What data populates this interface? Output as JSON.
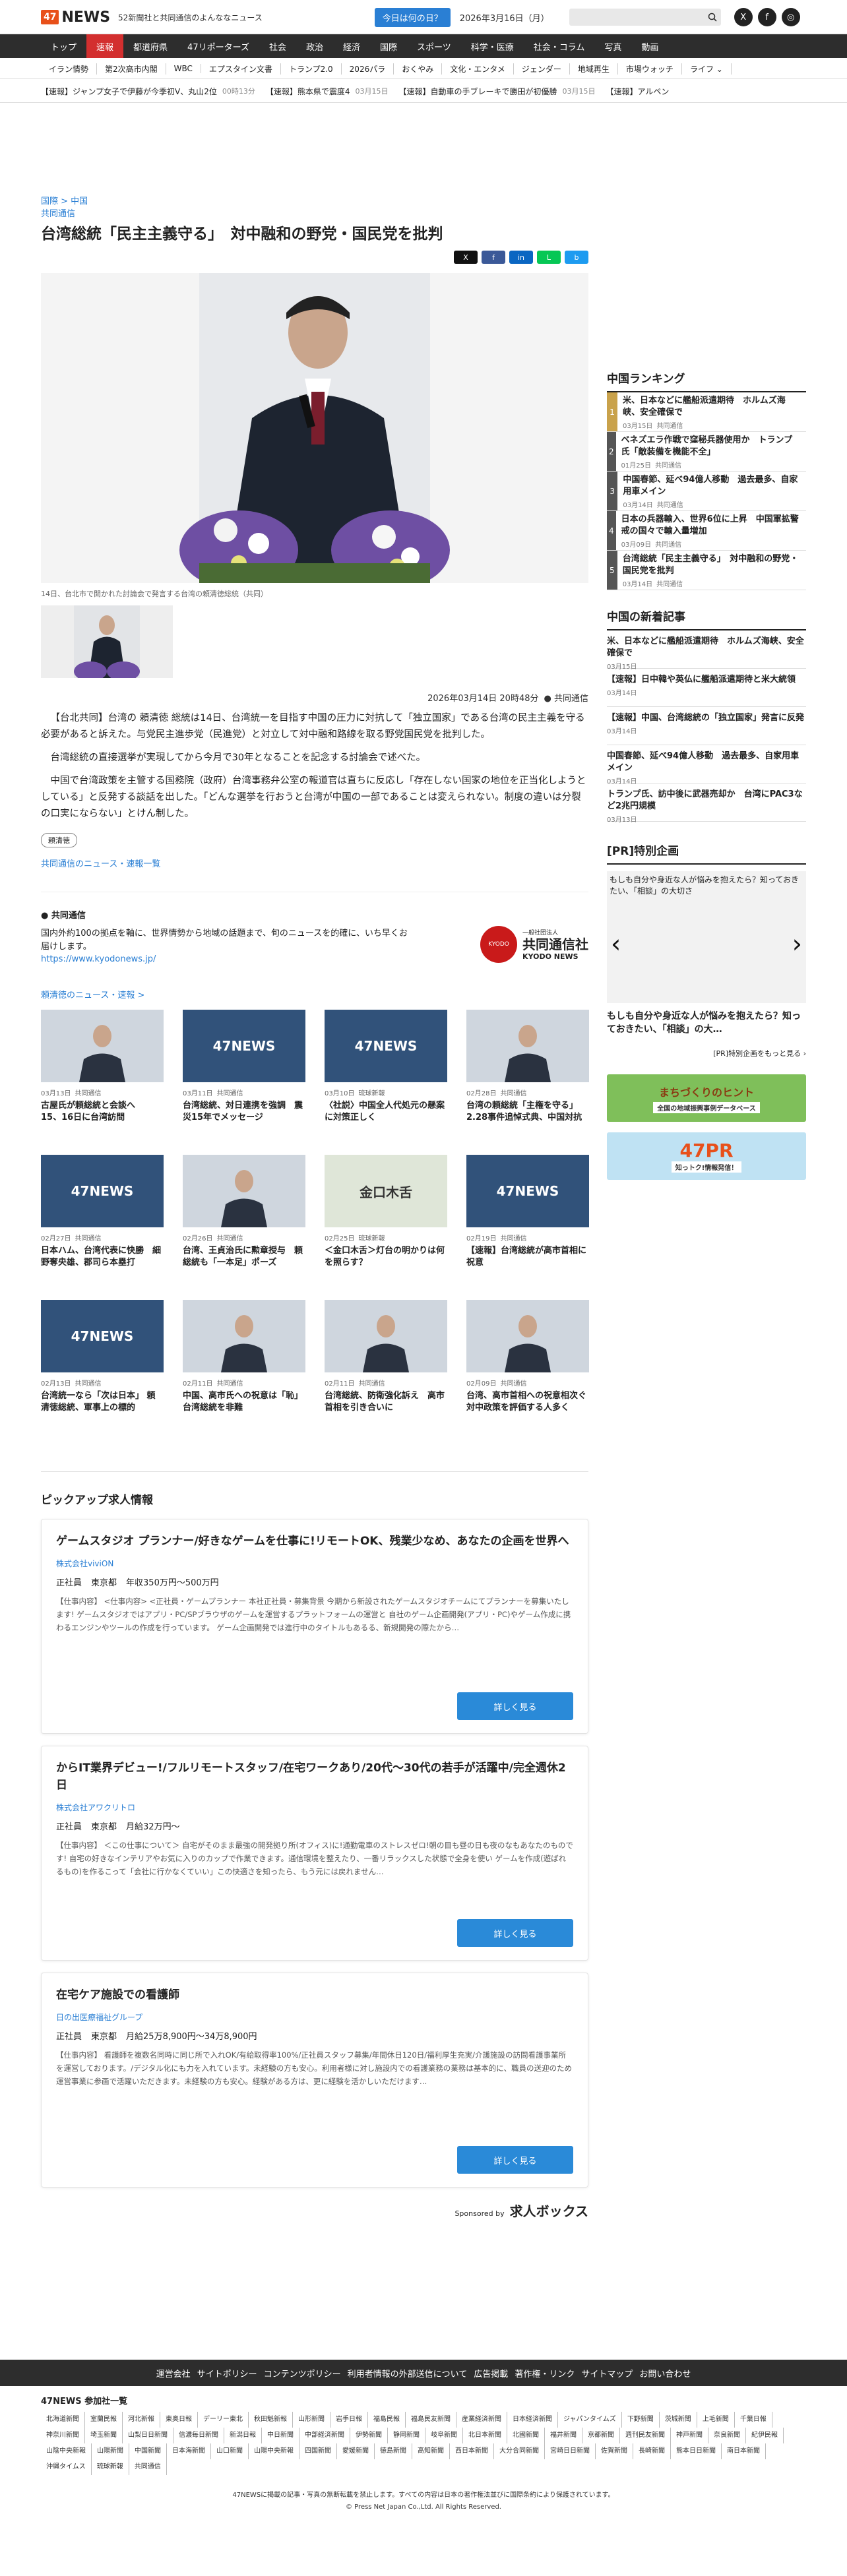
{
  "header": {
    "logo_box": "47",
    "logo_text": "NEWS",
    "tagline": "52新聞社と共同通信のよんななニュース",
    "today_button": "今日は何の日？",
    "date": "2026年3月16日（月）"
  },
  "gnav": [
    "トップ",
    "速報",
    "都道府県",
    "47リポーターズ",
    "社会",
    "政治",
    "経済",
    "国際",
    "スポーツ",
    "科学・医療",
    "社会・コラム",
    "写真",
    "動画"
  ],
  "subnav": [
    "イラン情勢",
    "第2次高市内閣",
    "WBC",
    "エプスタイン文書",
    "トランプ2.0",
    "2026パラ",
    "おくやみ",
    "文化・エンタメ",
    "ジェンダー",
    "地域再生",
    "市場ウォッチ",
    "ライフ ⌄"
  ],
  "ticker": [
    {
      "t": "【速報】ジャンプ女子で伊藤が今季初V、丸山2位",
      "d": "00時13分"
    },
    {
      "t": "【速報】熊本県で震度4",
      "d": "03月15日"
    },
    {
      "t": "【速報】自動車の手ブレーキで勝田が初優勝",
      "d": "03月15日"
    },
    {
      "t": "【速報】アルペン",
      "d": ""
    }
  ],
  "article": {
    "crumb1": "国際 > 中国",
    "crumb2": "共同通信",
    "title": "台湾総統「民主主義守る」　対中融和の野党・国民党を批判",
    "caption": "14日、台北市で開かれた討論会で発言する台湾の頼清徳総統（共同）",
    "datetime": "2026年03月14日 20時48分",
    "source": "共同通信",
    "p1": "【台北共同】台湾の 頼清徳 総統は14日、台湾統一を目指す中国の圧力に対抗して「独立国家」である台湾の民主主義を守る必要があると訴えた。与党民主進歩党（民進党）と対立して対中融和路線を取る野党国民党を批判した。",
    "p2": "台湾総統の直接選挙が実現してから今月で30年となることを記念する討論会で述べた。",
    "p3": "中国で台湾政策を主管する国務院（政府）台湾事務弁公室の報道官は直ちに反応し「存在しない国家の地位を正当化しようとしている」と反発する談話を出した。「どんな選挙を行おうと台湾が中国の一部であることは変えられない。制度の違いは分裂の口実にならない」とけん制した。",
    "tag": "頼清徳",
    "more": "共同通信のニュース・速報一覧"
  },
  "kyodo": {
    "title": "共同通信",
    "desc": "国内外約100の拠点を軸に、世界情勢から地域の話題まで、旬のニュースを的確に、いち早くお届けします。",
    "url": "https://www.kyodonews.jp/",
    "logo_small": "一般社団法人",
    "logo_name": "共同通信社",
    "logo_en": "KYODO NEWS",
    "mark": "KYODO"
  },
  "related": {
    "title": "頼清徳のニュース・速報 >",
    "cards": [
      {
        "date": "03月13日",
        "src": "共同通信",
        "title": "古屋氏が頼総統と会談へ　15、16日に台湾訪問",
        "img": ""
      },
      {
        "date": "03月11日",
        "src": "共同通信",
        "title": "台湾総統、対日連携を強調　震災15年でメッセージ",
        "img": "47NEWS"
      },
      {
        "date": "03月10日",
        "src": "琉球新報",
        "title": "〈社説〉中国全人代処元の懸案に対策正しく",
        "img": "47NEWS"
      },
      {
        "date": "02月28日",
        "src": "共同通信",
        "title": "台湾の頼総統「主権を守る」 2.28事件追悼式典、中国対抗",
        "img": ""
      },
      {
        "date": "02月27日",
        "src": "共同通信",
        "title": "日本ハム、台湾代表に快勝　細野奪央雄、郡司ら本塁打",
        "img": "47NEWS"
      },
      {
        "date": "02月26日",
        "src": "共同通信",
        "title": "台湾、王貞治氏に勲章授与　頼総統も「一本足」ポーズ",
        "img": ""
      },
      {
        "date": "02月25日",
        "src": "琉球新報",
        "title": "＜金口木舌＞灯台の明かりは何を照らす？",
        "img": "金口木舌"
      },
      {
        "date": "02月19日",
        "src": "共同通信",
        "title": "【速報】台湾総統が高市首相に祝意",
        "img": "47NEWS"
      },
      {
        "date": "02月13日",
        "src": "共同通信",
        "title": "台湾統一なら「次は日本」 頼清徳総統、軍事上の標的",
        "img": "47NEWS"
      },
      {
        "date": "02月11日",
        "src": "共同通信",
        "title": "中国、高市氏への祝意は「恥」 台湾総統を非難",
        "img": ""
      },
      {
        "date": "02月11日",
        "src": "共同通信",
        "title": "台湾総統、防衛強化訴え　高市首相を引き合いに",
        "img": ""
      },
      {
        "date": "02月09日",
        "src": "共同通信",
        "title": "台湾、高市首相への祝意相次ぐ　対中政策を評価する人多く",
        "img": ""
      }
    ]
  },
  "jobs": {
    "heading": "ピックアップ求人情報",
    "more": "詳しく見る",
    "sponsor": "Sponsored by",
    "sponsor_name": "求人ボックス",
    "items": [
      {
        "title": "ゲームスタジオ プランナー/好きなゲームを仕事に!リモートOK、残業少なめ、あなたの企画を世界へ",
        "company": "株式会社viviON",
        "type": "正社員",
        "loc": "東京都",
        "pay": "年収350万円〜500万円",
        "desc": "【仕事内容】 <仕事内容> <正社員・ゲームプランナー 本社正社員・募集背景 今期から新設されたゲームスタジオチームにてプランナーを募集いたします! ゲームスタジオではアプリ・PC/SPブラウザのゲームを運営するプラットフォームの運営と 自社のゲーム企画開発(アプリ・PC)やゲーム作成に携わるエンジンやツールの作成を行っています。 ゲーム企画開発では進行中のタイトルもあるる、新規開発の際たから…"
      },
      {
        "title": "からIT業界デビュー!/フルリモートスタッフ/在宅ワークあり/20代〜30代の若手が活躍中/完全週休2日",
        "company": "株式会社アワクリトロ",
        "type": "正社員",
        "loc": "東京都",
        "pay": "月給32万円〜",
        "desc": "【仕事内容】 ＜この仕事について＞ 自宅がそのまま最強の開発拠り所(オフィス)に!通勤電車のストレスゼロ!朝の目も昼の日も夜のなもあなたのものです! 自宅の好きなインテリアやお気に入りのカップで作業できます。通信環境を整えたり、一番リラックスした状態で全身を使い ゲームを作成(遊ばれるもの)を作るこって「会社に行かなくていい」この快適さを知ったら、もう元には戻れません…"
      },
      {
        "title": "在宅ケア施設での看護師",
        "company": "日の出医療福祉グループ",
        "type": "正社員",
        "loc": "東京都",
        "pay": "月給25万8,900円〜34万8,900円",
        "desc": "【仕事内容】 看護師を複数名同時に同じ所で入れOK/有給取得率100%/正社員スタッフ募集/年間休日120日/福利厚生充実/介護施設の訪問看護事業所を運営しております。/デジタル化にも力を入れています。未経験の方も安心。利用者様に対し施設内での看護業務の業務は基本的に、職員の送迎のため運営事業に参画で活躍いただきます。未経験の方も安心。経験がある方は、更に経験を活かしいただけます…"
      }
    ]
  },
  "sidebar": {
    "ranking_title": "中国ランキング",
    "ranking": [
      {
        "t": "米、日本などに艦船派遣期待　ホルムズ海峡、安全確保で",
        "d": "03月15日",
        "s": "共同通信"
      },
      {
        "t": "ベネズエラ作戦で窪秘兵器使用か　トランプ氏「敵装備を機能不全」",
        "d": "01月25日",
        "s": "共同通信"
      },
      {
        "t": "中国春節、延べ94億人移動　過去最多、自家用車メイン",
        "d": "03月14日",
        "s": "共同通信"
      },
      {
        "t": "日本の兵器輸入、世界6位に上昇　中国軍拡警戒の国々で輸入量増加",
        "d": "03月09日",
        "s": "共同通信"
      },
      {
        "t": "台湾総統「民主主義守る」　対中融和の野党・国民党を批判",
        "d": "03月14日",
        "s": "共同通信"
      }
    ],
    "newest_title": "中国の新着記事",
    "newest": [
      {
        "t": "米、日本などに艦船派遣期待　ホルムズ海峡、安全確保で",
        "d": "03月15日"
      },
      {
        "t": "【速報】日中韓や英仏に艦船派遣期待と米大統領",
        "d": "03月14日"
      },
      {
        "t": "【速報】中国、台湾総統の「独立国家」発言に反発",
        "d": "03月14日"
      },
      {
        "t": "中国春節、延べ94億人移動　過去最多、自家用車メイン",
        "d": "03月14日"
      },
      {
        "t": "トランプ氏、訪中後に武器売却か　台湾にPAC3など2兆円規模",
        "d": "03月13日"
      }
    ],
    "pr_title": "[PR]特別企画",
    "pr_img_alt": "もしも自分や身近な人が悩みを抱えたら？知っておきたい、「相談」の大切さ",
    "pr_caption": "もしも自分や身近な人が悩みを抱えたら？知っておきたい、「相談」の大…",
    "pr_more": "[PR]特別企画をもっと見る ›",
    "banner1": "まちづくりのヒント",
    "banner1_sub": "全国の地域振興事例データベース",
    "banner2": "47PR",
    "banner2_sub": "知っトク!情報発信！"
  },
  "footer": {
    "links": [
      "運営会社",
      "サイトポリシー",
      "コンテンツポリシー",
      "利用者情報の外部送信について",
      "広告掲載",
      "著作権・リンク",
      "サイトマップ",
      "お問い合わせ"
    ],
    "members_title": "47NEWS 参加社一覧",
    "papers": [
      "北海道新聞",
      "室蘭民報",
      "河北新報",
      "東奥日報",
      "デーリー東北",
      "秋田魁新報",
      "山形新聞",
      "岩手日報",
      "福島民報",
      "福島民友新聞",
      "産業経済新聞",
      "日本経済新聞",
      "ジャパンタイムズ",
      "下野新聞",
      "茨城新聞",
      "上毛新聞",
      "千葉日報",
      "神奈川新聞",
      "埼玉新聞",
      "山梨日日新聞",
      "信濃毎日新聞",
      "新潟日報",
      "中日新聞",
      "中部経済新聞",
      "伊勢新聞",
      "静岡新聞",
      "岐阜新聞",
      "北日本新聞",
      "北國新聞",
      "福井新聞",
      "京都新聞",
      "週刊民友新聞",
      "神戸新聞",
      "奈良新聞",
      "紀伊民報",
      "山陰中央新報",
      "山陽新聞",
      "中国新聞",
      "日本海新聞",
      "山口新聞",
      "山陽中央新報",
      "四国新聞",
      "愛媛新聞",
      "徳島新聞",
      "高知新聞",
      "西日本新聞",
      "大分合同新聞",
      "宮崎日日新聞",
      "佐賀新聞",
      "長崎新聞",
      "熊本日日新聞",
      "南日本新聞",
      "沖縄タイムス",
      "琉球新報",
      "共同通信"
    ],
    "notice": "47NEWSに掲載の記事・写真の無断転載を禁止します。すべての内容は日本の著作権法並びに国際条約により保護されています。",
    "copyright": "© Press Net Japan Co.,Ltd. All Rights Reserved."
  }
}
